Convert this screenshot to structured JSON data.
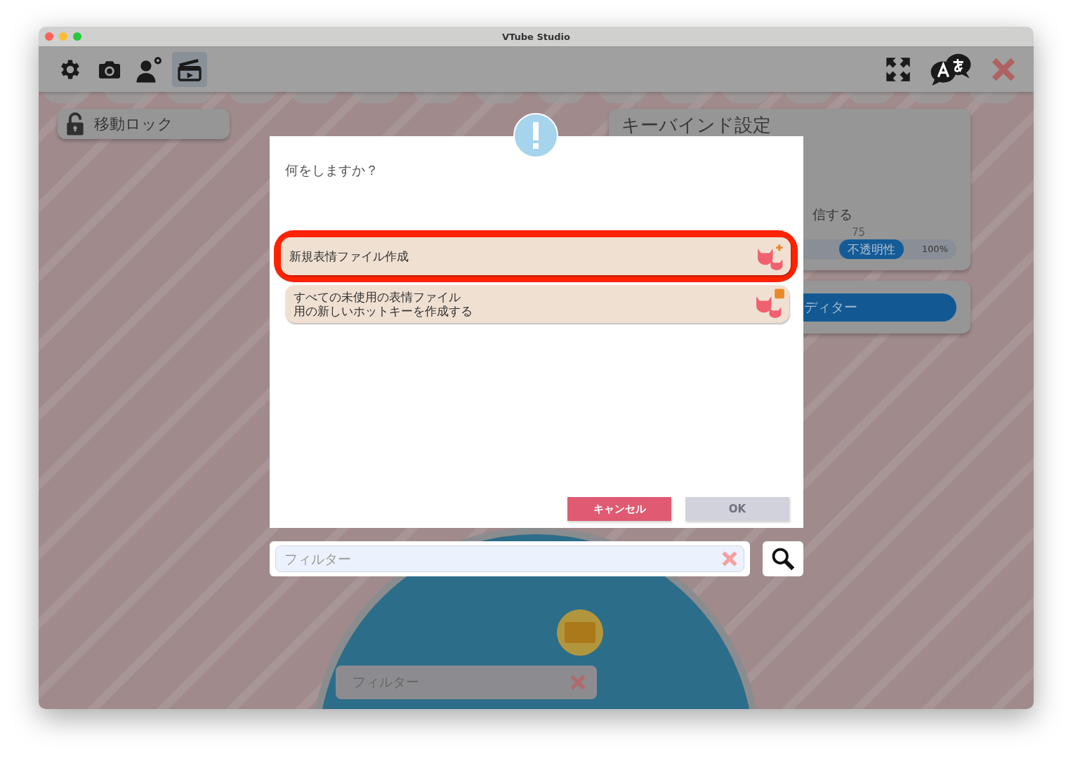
{
  "window": {
    "title": "VTube Studio"
  },
  "toolbar": {
    "left": [
      {
        "kind": "settings",
        "selected": false
      },
      {
        "kind": "camera",
        "selected": false
      },
      {
        "kind": "person-settings",
        "selected": false
      },
      {
        "kind": "clapperboard",
        "selected": true
      }
    ],
    "right": [
      {
        "kind": "expand"
      },
      {
        "kind": "language"
      },
      {
        "kind": "close"
      }
    ]
  },
  "movement_lock": {
    "label": "移動ロック",
    "locked": false
  },
  "keybind_panel": {
    "title": "キーバインド設定",
    "partial_text": "信する",
    "opacity_value": "75",
    "opacity_label": "不透明性",
    "opacity_max": "100%",
    "level": 0.75
  },
  "editor_button": {
    "label": "ディター"
  },
  "dialog": {
    "question": "何をしますか？",
    "options": [
      {
        "label": "新規表情ファイル作成",
        "selected": true,
        "kind": "new"
      },
      {
        "label_lines": [
          "すべての未使用の表情ファイル",
          "用の新しいホットキーを作成する"
        ],
        "selected": false,
        "kind": "bulk"
      }
    ],
    "buttons": [
      {
        "label": "キャンセル",
        "kind": "cancel",
        "disabled": false
      },
      {
        "label": "OK",
        "kind": "ok",
        "disabled": true
      }
    ]
  },
  "filter": {
    "placeholder": "フィルター"
  },
  "background_filter": {
    "placeholder": "フィルター"
  }
}
